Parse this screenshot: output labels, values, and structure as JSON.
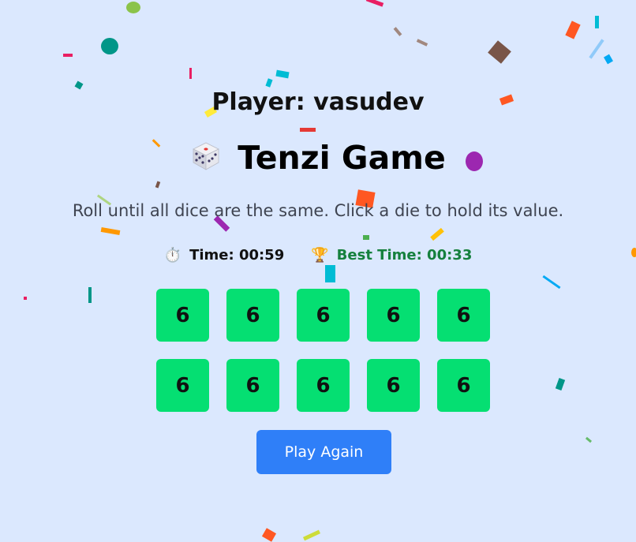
{
  "header": {
    "player": "Player: vasudev",
    "title": "Tenzi Game",
    "instructions": "Roll until all dice are the same. Click a die to hold its value."
  },
  "stats": {
    "time": "Time: 00:59",
    "best": "Best Time: 00:33",
    "timer_icon": "stopwatch-icon",
    "best_icon": "trophy-icon"
  },
  "dice": [
    "6",
    "6",
    "6",
    "6",
    "6",
    "6",
    "6",
    "6",
    "6",
    "6"
  ],
  "dice_held": [
    true,
    true,
    true,
    true,
    true,
    true,
    true,
    true,
    true,
    true
  ],
  "actions": {
    "play_again": "Play Again"
  },
  "colors": {
    "background": "#dbe8fe",
    "held_die": "#05df72",
    "button": "#2f7ff8",
    "best_time": "#15803d"
  }
}
